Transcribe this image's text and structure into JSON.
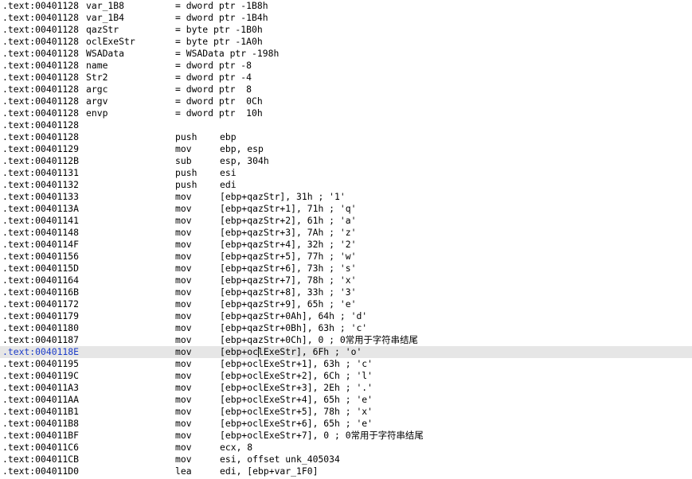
{
  "listing": {
    "rows": [
      {
        "addr": ".text:00401128",
        "name": "var_1B8",
        "eq": "= dword ptr -1B8h"
      },
      {
        "addr": ".text:00401128",
        "name": "var_1B4",
        "eq": "= dword ptr -1B4h"
      },
      {
        "addr": ".text:00401128",
        "name": "qazStr",
        "eq": "= byte ptr -1B0h"
      },
      {
        "addr": ".text:00401128",
        "name": "oclExeStr",
        "eq": "= byte ptr -1A0h"
      },
      {
        "addr": ".text:00401128",
        "name": "WSAData",
        "eq": "= WSAData ptr -198h"
      },
      {
        "addr": ".text:00401128",
        "name": "name",
        "eq": "= dword ptr -8"
      },
      {
        "addr": ".text:00401128",
        "name": "Str2",
        "eq": "= dword ptr -4"
      },
      {
        "addr": ".text:00401128",
        "name": "argc",
        "eq": "= dword ptr  8"
      },
      {
        "addr": ".text:00401128",
        "name": "argv",
        "eq": "= dword ptr  0Ch"
      },
      {
        "addr": ".text:00401128",
        "name": "envp",
        "eq": "= dword ptr  10h"
      },
      {
        "addr": ".text:00401128"
      },
      {
        "addr": ".text:00401128",
        "mn": "push",
        "ops": "ebp"
      },
      {
        "addr": ".text:00401129",
        "mn": "mov",
        "ops": "ebp, esp"
      },
      {
        "addr": ".text:0040112B",
        "mn": "sub",
        "ops": "esp, 304h"
      },
      {
        "addr": ".text:00401131",
        "mn": "push",
        "ops": "esi"
      },
      {
        "addr": ".text:00401132",
        "mn": "push",
        "ops": "edi"
      },
      {
        "addr": ".text:00401133",
        "mn": "mov",
        "ops": "[ebp+qazStr], 31h ; '1'"
      },
      {
        "addr": ".text:0040113A",
        "mn": "mov",
        "ops": "[ebp+qazStr+1], 71h ; 'q'"
      },
      {
        "addr": ".text:00401141",
        "mn": "mov",
        "ops": "[ebp+qazStr+2], 61h ; 'a'"
      },
      {
        "addr": ".text:00401148",
        "mn": "mov",
        "ops": "[ebp+qazStr+3], 7Ah ; 'z'"
      },
      {
        "addr": ".text:0040114F",
        "mn": "mov",
        "ops": "[ebp+qazStr+4], 32h ; '2'"
      },
      {
        "addr": ".text:00401156",
        "mn": "mov",
        "ops": "[ebp+qazStr+5], 77h ; 'w'"
      },
      {
        "addr": ".text:0040115D",
        "mn": "mov",
        "ops": "[ebp+qazStr+6], 73h ; 's'"
      },
      {
        "addr": ".text:00401164",
        "mn": "mov",
        "ops": "[ebp+qazStr+7], 78h ; 'x'"
      },
      {
        "addr": ".text:0040116B",
        "mn": "mov",
        "ops": "[ebp+qazStr+8], 33h ; '3'"
      },
      {
        "addr": ".text:00401172",
        "mn": "mov",
        "ops": "[ebp+qazStr+9], 65h ; 'e'"
      },
      {
        "addr": ".text:00401179",
        "mn": "mov",
        "ops": "[ebp+qazStr+0Ah], 64h ; 'd'"
      },
      {
        "addr": ".text:00401180",
        "mn": "mov",
        "ops": "[ebp+qazStr+0Bh], 63h ; 'c'"
      },
      {
        "addr": ".text:00401187",
        "mn": "mov",
        "ops": "[ebp+qazStr+0Ch], 0 ; 0常用于字符串结尾"
      },
      {
        "addr": ".text:0040118E",
        "mn": "mov",
        "ops": "[ebp+oclExeStr], 6Fh ; 'o'",
        "selected": true
      },
      {
        "addr": ".text:00401195",
        "mn": "mov",
        "ops": "[ebp+oclExeStr+1], 63h ; 'c'"
      },
      {
        "addr": ".text:0040119C",
        "mn": "mov",
        "ops": "[ebp+oclExeStr+2], 6Ch ; 'l'"
      },
      {
        "addr": ".text:004011A3",
        "mn": "mov",
        "ops": "[ebp+oclExeStr+3], 2Eh ; '.'"
      },
      {
        "addr": ".text:004011AA",
        "mn": "mov",
        "ops": "[ebp+oclExeStr+4], 65h ; 'e'"
      },
      {
        "addr": ".text:004011B1",
        "mn": "mov",
        "ops": "[ebp+oclExeStr+5], 78h ; 'x'"
      },
      {
        "addr": ".text:004011B8",
        "mn": "mov",
        "ops": "[ebp+oclExeStr+6], 65h ; 'e'"
      },
      {
        "addr": ".text:004011BF",
        "mn": "mov",
        "ops": "[ebp+oclExeStr+7], 0 ; 0常用于字符串结尾"
      },
      {
        "addr": ".text:004011C6",
        "mn": "mov",
        "ops": "ecx, 8"
      },
      {
        "addr": ".text:004011CB",
        "mn": "mov",
        "ops": "esi, offset unk_405034"
      },
      {
        "addr": ".text:004011D0",
        "mn": "lea",
        "ops": "edi, [ebp+var_1F0]"
      }
    ]
  }
}
